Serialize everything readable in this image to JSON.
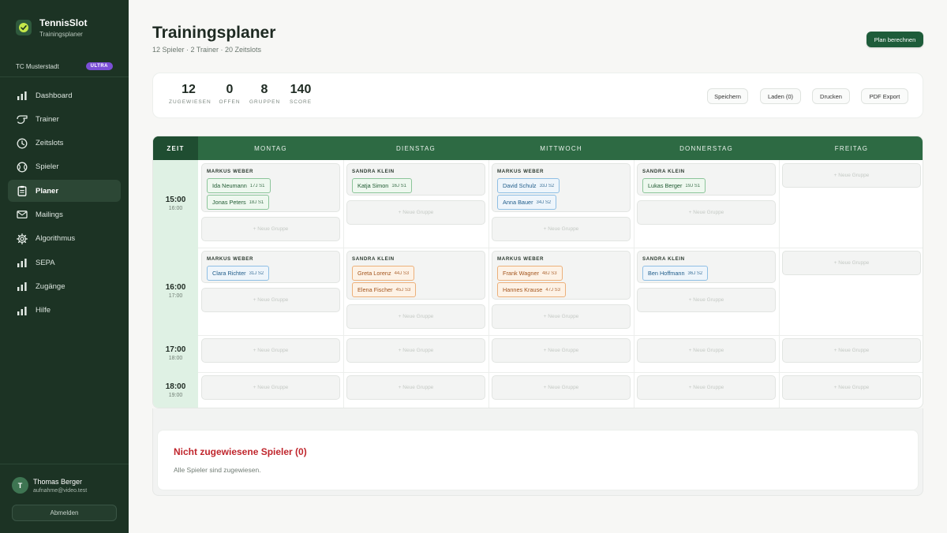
{
  "app": {
    "name": "TennisSlot",
    "subtitle": "Trainingsplaner"
  },
  "club": {
    "name": "TC Musterstadt",
    "tier": "ULTRA"
  },
  "nav": [
    {
      "label": "Dashboard",
      "icon": "bar-chart-icon",
      "active": false
    },
    {
      "label": "Trainer",
      "icon": "whistle-icon",
      "active": false
    },
    {
      "label": "Zeitslots",
      "icon": "clock-icon",
      "active": false
    },
    {
      "label": "Spieler",
      "icon": "ball-icon",
      "active": false
    },
    {
      "label": "Planer",
      "icon": "clipboard-icon",
      "active": true
    },
    {
      "label": "Mailings",
      "icon": "mail-icon",
      "active": false
    },
    {
      "label": "Algorithmus",
      "icon": "gear-icon",
      "active": false
    },
    {
      "label": "SEPA",
      "icon": "bar-chart-icon",
      "active": false
    },
    {
      "label": "Zugänge",
      "icon": "bar-chart-icon",
      "active": false
    },
    {
      "label": "Hilfe",
      "icon": "bar-chart-icon",
      "active": false
    }
  ],
  "user": {
    "initial": "T",
    "name": "Thomas Berger",
    "email": "aufnahme@video.test",
    "logout_label": "Abmelden"
  },
  "header": {
    "title": "Trainingsplaner",
    "subtitle": "12 Spieler · 2 Trainer · 20 Zeitslots",
    "primary_action": "Plan berechnen"
  },
  "stats": [
    {
      "value": "12",
      "label": "ZUGEWIESEN"
    },
    {
      "value": "0",
      "label": "OFFEN"
    },
    {
      "value": "8",
      "label": "GRUPPEN"
    },
    {
      "value": "140",
      "label": "SCORE"
    }
  ],
  "actions": {
    "save": "Speichern",
    "load": "Laden (0)",
    "print": "Drucken",
    "pdf": "PDF Export"
  },
  "schedule": {
    "time_header": "ZEIT",
    "days": [
      "MONTAG",
      "DIENSTAG",
      "MITTWOCH",
      "DONNERSTAG",
      "FREITAG"
    ],
    "new_group_label": "+ Neue Gruppe",
    "slots": [
      {
        "start": "15:00",
        "end": "16:00"
      },
      {
        "start": "16:00",
        "end": "17:00"
      },
      {
        "start": "17:00",
        "end": "18:00"
      },
      {
        "start": "18:00",
        "end": "19:00"
      }
    ],
    "groups": {
      "s0d0": {
        "trainer": "MARKUS WEBER",
        "players": [
          {
            "name": "Ida Neumann",
            "meta": "17J S1",
            "color": "green"
          },
          {
            "name": "Jonas Peters",
            "meta": "18J S1",
            "color": "green"
          }
        ]
      },
      "s0d1": {
        "trainer": "SANDRA KLEIN",
        "players": [
          {
            "name": "Katja Simon",
            "meta": "16J S1",
            "color": "green"
          }
        ]
      },
      "s0d2": {
        "trainer": "MARKUS WEBER",
        "players": [
          {
            "name": "David Schulz",
            "meta": "33J S2",
            "color": "blue"
          },
          {
            "name": "Anna Bauer",
            "meta": "34J S2",
            "color": "blue"
          }
        ]
      },
      "s0d3": {
        "trainer": "SANDRA KLEIN",
        "players": [
          {
            "name": "Lukas Berger",
            "meta": "19J S1",
            "color": "green"
          }
        ]
      },
      "s1d0": {
        "trainer": "MARKUS WEBER",
        "players": [
          {
            "name": "Clara Richter",
            "meta": "31J S2",
            "color": "blue"
          }
        ]
      },
      "s1d1": {
        "trainer": "SANDRA KLEIN",
        "players": [
          {
            "name": "Greta Lorenz",
            "meta": "44J S3",
            "color": "orange"
          },
          {
            "name": "Elena Fischer",
            "meta": "45J S3",
            "color": "orange"
          }
        ]
      },
      "s1d2": {
        "trainer": "MARKUS WEBER",
        "players": [
          {
            "name": "Frank Wagner",
            "meta": "48J S3",
            "color": "orange"
          },
          {
            "name": "Hannes Krause",
            "meta": "47J S3",
            "color": "orange"
          }
        ]
      },
      "s1d3": {
        "trainer": "SANDRA KLEIN",
        "players": [
          {
            "name": "Ben Hoffmann",
            "meta": "36J S2",
            "color": "blue"
          }
        ]
      }
    }
  },
  "unassigned": {
    "title": "Nicht zugewiesene Spieler (0)",
    "note": "Alle Spieler sind zugewiesen."
  },
  "colors": {
    "sidebar": "#1c3324",
    "header_green": "#2d6a43",
    "primary": "#1e5c3a",
    "badge": "#7b4fd6",
    "alert": "#c0262d"
  }
}
